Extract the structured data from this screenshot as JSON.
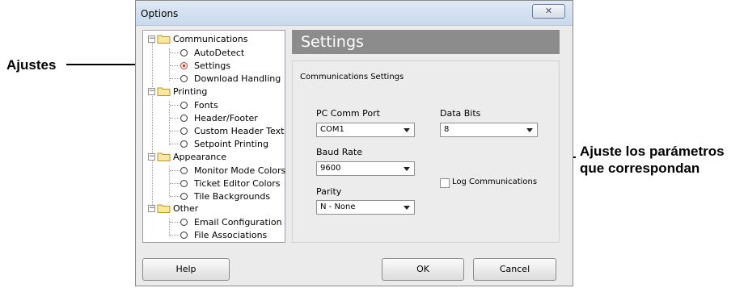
{
  "window": {
    "title": "Options",
    "close_symbol": "✕"
  },
  "tree": {
    "groups": [
      {
        "label": "Communications",
        "items": [
          "AutoDetect",
          "Settings",
          "Download Handling"
        ]
      },
      {
        "label": "Printing",
        "items": [
          "Fonts",
          "Header/Footer",
          "Custom Header Text",
          "Setpoint Printing"
        ]
      },
      {
        "label": "Appearance",
        "items": [
          "Monitor Mode Colors",
          "Ticket Editor Colors",
          "Tile Backgrounds"
        ]
      },
      {
        "label": "Other",
        "items": [
          "Email Configuration",
          "File Associations"
        ]
      }
    ],
    "selected": "Settings",
    "expander_symbol": "−"
  },
  "panel": {
    "heading": "Settings",
    "section_title": "Communications Settings",
    "pc_comm_port": {
      "label": "PC Comm Port",
      "value": "COM1"
    },
    "baud_rate": {
      "label": "Baud Rate",
      "value": "9600"
    },
    "parity": {
      "label": "Parity",
      "value": "N - None"
    },
    "data_bits": {
      "label": "Data Bits",
      "value": "8"
    },
    "log_communications": {
      "label": "Log Communications",
      "checked": false
    }
  },
  "buttons": {
    "help": "Help",
    "ok": "OK",
    "cancel": "Cancel"
  },
  "callouts": {
    "left": "Ajustes",
    "right_line1": "Ajuste los parámetros",
    "right_line2": "que correspondan"
  },
  "colors": {
    "panel_header": "#8c8c8c",
    "selected_bullet": "#d23a2a"
  }
}
